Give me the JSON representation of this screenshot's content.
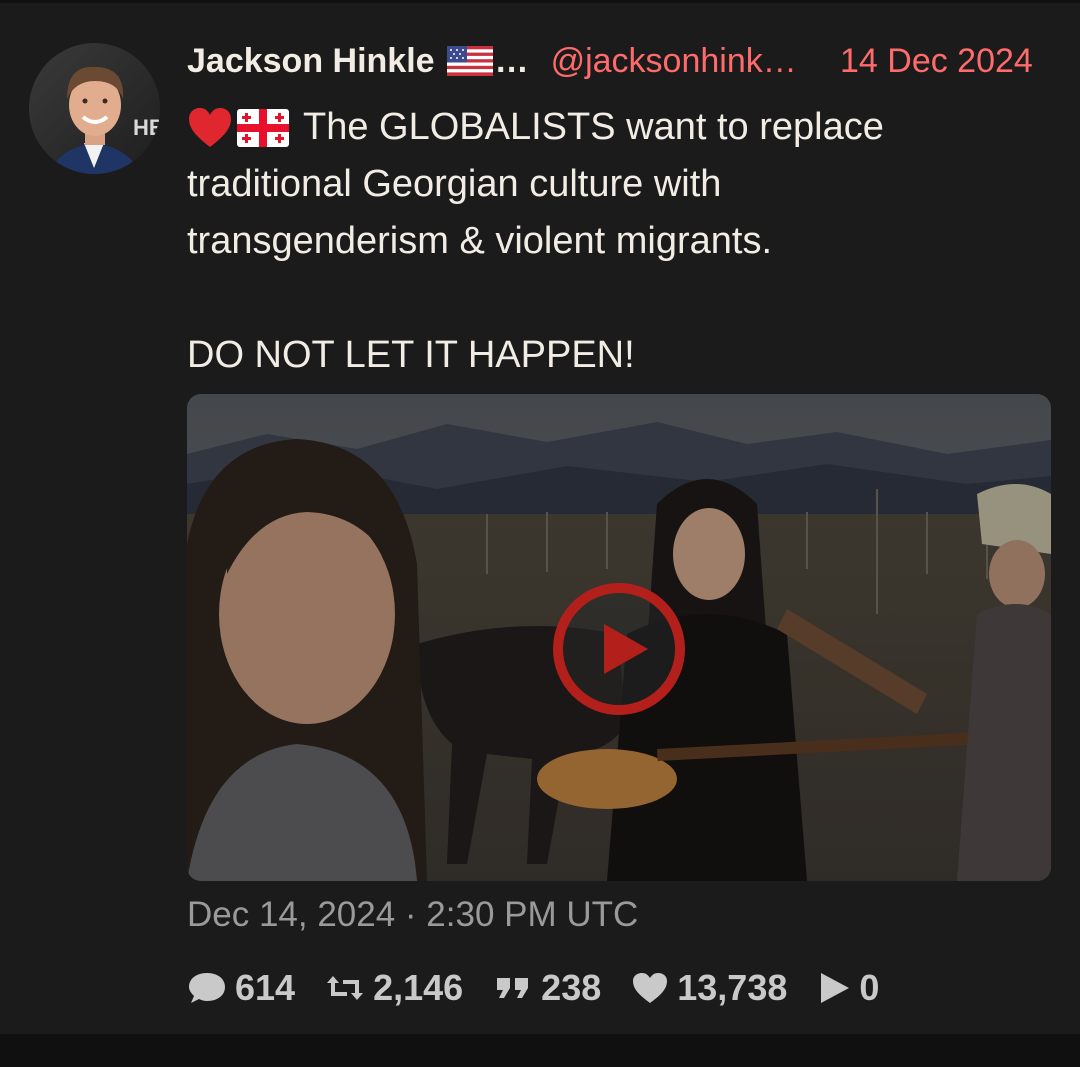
{
  "tweet": {
    "author_name": "Jackson Hinkle",
    "name_ellipsis": "…",
    "handle": "@jacksonhink…",
    "date": "14 Dec 2024",
    "text_line1": "The GLOBALISTS want to replace",
    "text_line2": "traditional Georgian culture with",
    "text_line3": "transgenderism & violent migrants.",
    "text_para2": "DO NOT LET IT HAPPEN!",
    "timestamp": "Dec 14, 2024 · 2:30 PM UTC",
    "stats": {
      "replies": "614",
      "retweets": "2,146",
      "quotes": "238",
      "likes": "13,738",
      "plays": "0"
    }
  },
  "colors": {
    "background": "#1b1b1c",
    "accent": "#ff6b6b",
    "text": "#f1ede4",
    "muted": "#9a9a9a",
    "play_button": "#b3201c"
  },
  "icons": [
    "comment-icon",
    "retweet-icon",
    "quote-icon",
    "heart-icon",
    "play-icon",
    "us-flag-icon",
    "georgia-flag-icon",
    "red-heart-icon"
  ]
}
